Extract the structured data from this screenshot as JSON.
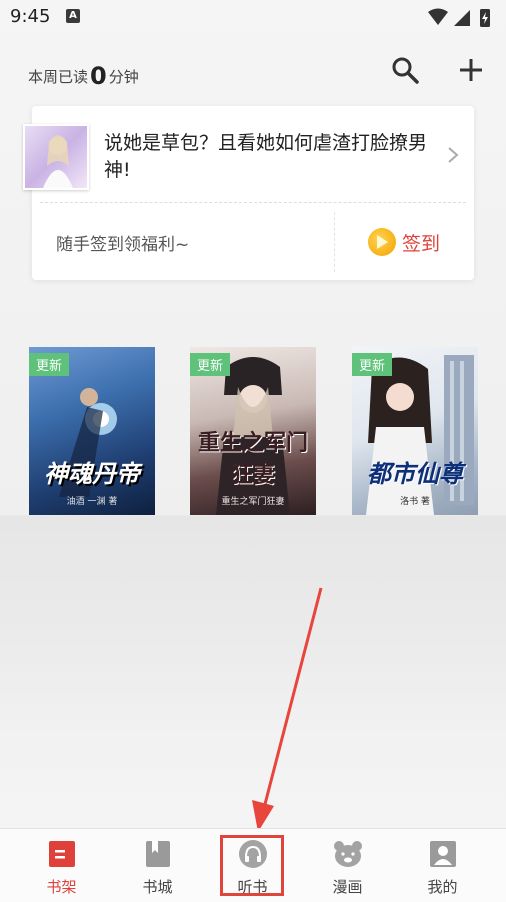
{
  "status_bar": {
    "time": "9:45",
    "notif_letter": "A"
  },
  "header": {
    "weekly_prefix": "本周已读",
    "weekly_minutes": "0",
    "weekly_unit": "分钟",
    "search_icon": "search-icon",
    "add_icon": "plus-icon"
  },
  "recommend_card": {
    "title": "说她是草包？且看她如何虐渣打脸撩男神!",
    "promo_text": "随手签到领福利~",
    "signin_label": "签到"
  },
  "books": [
    {
      "badge": "更新",
      "cover_title": "神魂丹帝",
      "cover_author": "油酒 一渊 著"
    },
    {
      "badge": "更新",
      "cover_title": "重生之军门狂妻",
      "cover_author": "重生之军门狂妻"
    },
    {
      "badge": "更新",
      "cover_title": "都市仙尊",
      "cover_author": "洛书 著"
    }
  ],
  "bottom_nav": {
    "items": [
      {
        "label": "书架",
        "icon": "bookshelf-icon",
        "active": true
      },
      {
        "label": "书城",
        "icon": "bookstore-icon",
        "active": false
      },
      {
        "label": "听书",
        "icon": "headphones-icon",
        "active": false
      },
      {
        "label": "漫画",
        "icon": "bear-icon",
        "active": false
      },
      {
        "label": "我的",
        "icon": "profile-icon",
        "active": false
      }
    ],
    "accent_color": "#e0403a"
  }
}
